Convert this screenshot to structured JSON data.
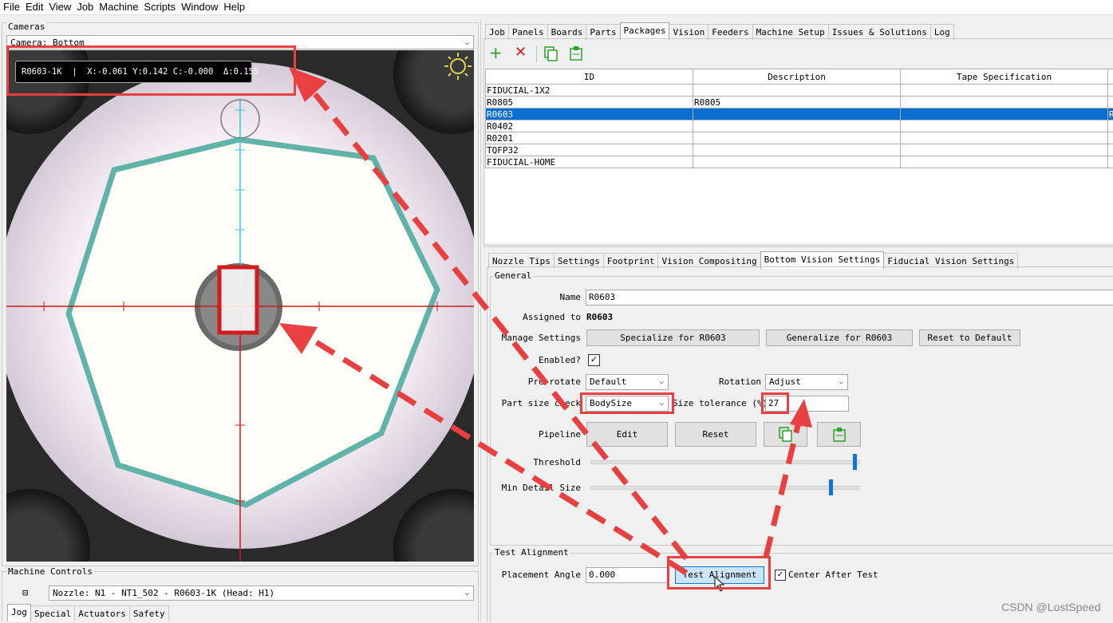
{
  "menu": [
    "File",
    "Edit",
    "View",
    "Job",
    "Machine",
    "Scripts",
    "Window",
    "Help"
  ],
  "cameras": {
    "group_title": "Cameras",
    "camera_select": "Camera: Bottom",
    "overlay": {
      "part": "R0603-1K",
      "sep": "|",
      "x": "X:-0.061",
      "y": "Y:0.142",
      "c": "C:-0.000",
      "delta": "Δ:0.155"
    }
  },
  "machine_controls": {
    "title": "Machine Controls",
    "collapse": "⊟",
    "nozzle_select": "Nozzle: N1 - NT1_502 - R0603-1K (Head: H1)",
    "tabs": [
      "Jog",
      "Special",
      "Actuators",
      "Safety"
    ]
  },
  "main_tabs": [
    "Job",
    "Panels",
    "Boards",
    "Parts",
    "Packages",
    "Vision",
    "Feeders",
    "Machine Setup",
    "Issues & Solutions",
    "Log"
  ],
  "main_tab_selected": 4,
  "packages_table": {
    "columns": [
      "ID",
      "Description",
      "Tape Specification"
    ],
    "rows": [
      [
        "FIDUCIAL-1X2",
        "",
        ""
      ],
      [
        "R0805",
        "R0805",
        ""
      ],
      [
        "R0603",
        "",
        ""
      ],
      [
        "R0402",
        "",
        ""
      ],
      [
        "R0201",
        "",
        ""
      ],
      [
        "TQFP32",
        "",
        ""
      ],
      [
        "FIDUCIAL-HOME",
        "",
        ""
      ]
    ],
    "selected_row": 2,
    "selected_overflow": "R"
  },
  "sub_tabs": [
    "Nozzle Tips",
    "Settings",
    "Footprint",
    "Vision Compositing",
    "Bottom Vision Settings",
    "Fiducial Vision Settings"
  ],
  "sub_tab_selected": 4,
  "general": {
    "title": "General",
    "name_label": "Name",
    "name_value": "R0603",
    "assigned_label": "Assigned to",
    "assigned_value": "R0603",
    "manage_label": "Manage Settings",
    "specialize_btn": "Specialize for  R0603",
    "generalize_btn": "Generalize for R0603",
    "reset_default_btn": "Reset to Default",
    "enabled_label": "Enabled?",
    "enabled_check": "✓",
    "prerotate_label": "Pre-rotate",
    "prerotate_value": "Default",
    "rotation_label": "Rotation",
    "rotation_value": "Adjust",
    "partsize_label": "Part size check",
    "partsize_value": "BodySize",
    "tolerance_label": "Size tolerance (%)",
    "tolerance_value": "27",
    "pipeline_label": "Pipeline",
    "edit_btn": "Edit",
    "reset_btn": "Reset",
    "threshold_label": "Threshold",
    "threshold_level": 0.99,
    "min_detail_label": "Min Detail Size",
    "min_detail_level": 0.9
  },
  "test_alignment": {
    "title": "Test Alignment",
    "angle_label": "Placement Angle",
    "angle_value": "0.000",
    "test_btn": "Test Alignment",
    "center_label": "Center After Test",
    "center_check": "✓"
  },
  "watermark": "CSDN @LostSpeed",
  "colors": {
    "selection": "#0a6fd1",
    "annotation": "#e84040",
    "crosshair_red": "#d01818",
    "crosshair_cyan": "#30c8e8",
    "icon_green": "#2aa02a",
    "icon_red": "#d41c1c"
  }
}
